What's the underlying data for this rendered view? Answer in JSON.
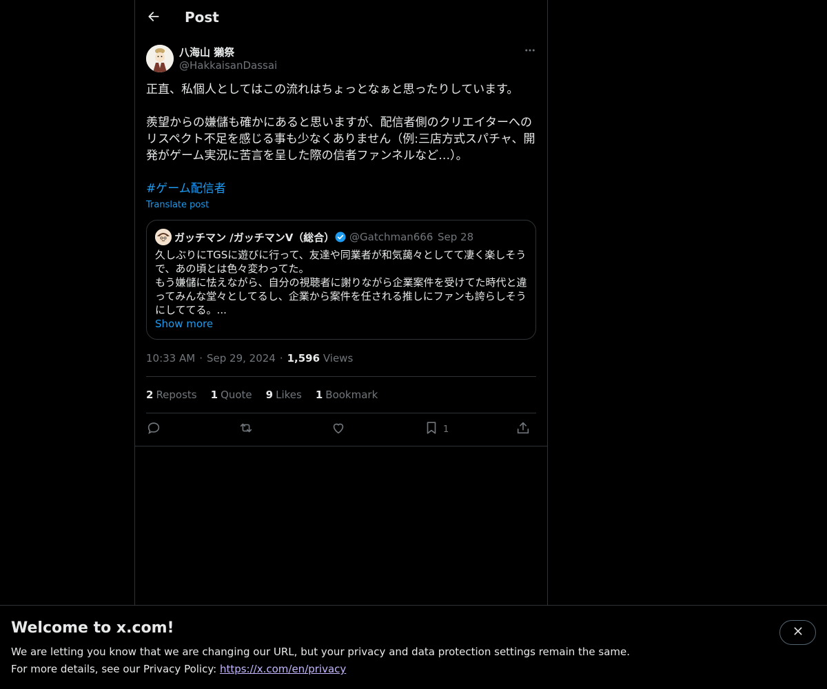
{
  "header": {
    "title": "Post"
  },
  "post": {
    "author_name": "八海山 獺祭",
    "author_handle": "@HakkaisanDassai",
    "text_line1": "正直、私個人としてはこの流れはちょっとなぁと思ったりしています。",
    "text_line2": "羨望からの嫌儲も確かにあると思いますが、配信者側のクリエイターへの",
    "text_line3": "リスペクト不足を感じる事も少なくありません（例:三店方式スパチャ、開",
    "text_line4": "発がゲーム実況に苦言を呈した際の信者ファンネルなど…）。",
    "hashtag": "#ゲーム配信者",
    "translate_label": "Translate post",
    "time": "10:33 AM",
    "date": "Sep 29, 2024",
    "views_count": "1,596",
    "views_label": "Views",
    "separator": "·"
  },
  "quote": {
    "author_name": "ガッチマン /ガッチマンV（総合）",
    "author_handle": "@Gatchman666",
    "separator": "·",
    "date": "Sep 28",
    "line1": "久しぶりにTGSに遊びに行って、友達や同業者が和気藹々としてて凄く楽しそう",
    "line2": "で、あの頃とは色々変わってた。",
    "line3": "もう嫌儲に怯えながら、自分の視聴者に謝りながら企業案件を受けてた時代と違",
    "line4": "ってみんな堂々としてるし、企業から案件を任される推しにファンも誇らしそう",
    "line5": "にしててる。...",
    "show_more": "Show more"
  },
  "stats": {
    "reposts_num": "2",
    "reposts_label": "Reposts",
    "quote_num": "1",
    "quote_label": "Quote",
    "likes_num": "9",
    "likes_label": "Likes",
    "bookmark_num": "1",
    "bookmark_label": "Bookmark"
  },
  "actions": {
    "reply_icon": "reply-icon",
    "repost_icon": "repost-icon",
    "like_icon": "heart-icon",
    "bookmark_icon": "bookmark-icon",
    "bookmark_count": "1",
    "share_icon": "share-icon"
  },
  "banner": {
    "title": "Welcome to x.com!",
    "line1": "We are letting you know that we are changing our URL, but your privacy and data protection settings remain the same.",
    "line2_prefix": "For more details, see our Privacy Policy: ",
    "privacy_url": "https://x.com/en/privacy"
  },
  "colors": {
    "background": "#000000",
    "accent": "#1d9bf0",
    "verified": "#1d9bf0",
    "muted_text": "#71767b",
    "border": "#2f3336"
  }
}
